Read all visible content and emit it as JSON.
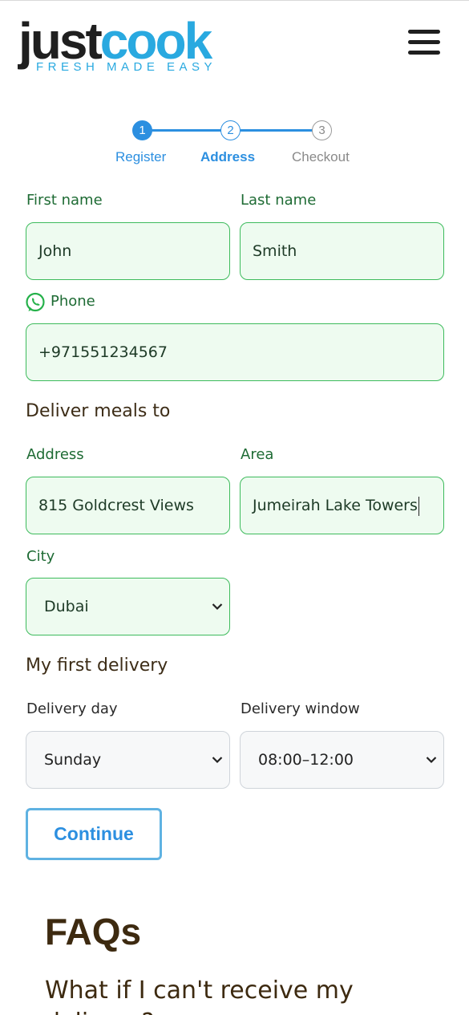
{
  "header": {
    "logo_just": "just",
    "logo_cook": "cook",
    "logo_tagline": "FRESH MADE EASY"
  },
  "stepper": {
    "steps": [
      {
        "number": "1",
        "label": "Register",
        "state": "done"
      },
      {
        "number": "2",
        "label": "Address",
        "state": "current"
      },
      {
        "number": "3",
        "label": "Checkout",
        "state": "todo"
      }
    ]
  },
  "form": {
    "first_name": {
      "label": "First name",
      "value": "John"
    },
    "last_name": {
      "label": "Last name",
      "value": "Smith"
    },
    "phone": {
      "label": "Phone",
      "value": "+971551234567"
    },
    "deliver_section": "Deliver meals to",
    "address": {
      "label": "Address",
      "value": "815 Goldcrest Views"
    },
    "area": {
      "label": "Area",
      "value": "Jumeirah Lake Towers"
    },
    "city": {
      "label": "City",
      "value": "Dubai"
    },
    "first_delivery_section": "My first delivery",
    "delivery_day": {
      "label": "Delivery day",
      "value": "Sunday"
    },
    "delivery_window": {
      "label": "Delivery window",
      "value": "08:00–12:00"
    },
    "continue_label": "Continue"
  },
  "faq": {
    "title": "FAQs",
    "question_1": "What if I can't receive my delivery?"
  },
  "colors": {
    "accent": "#2c8fe0",
    "brand_blue": "#29a9e0",
    "field_border": "#3dbb5c",
    "field_bg": "#eefbf0",
    "label_green": "#1e6b34"
  }
}
